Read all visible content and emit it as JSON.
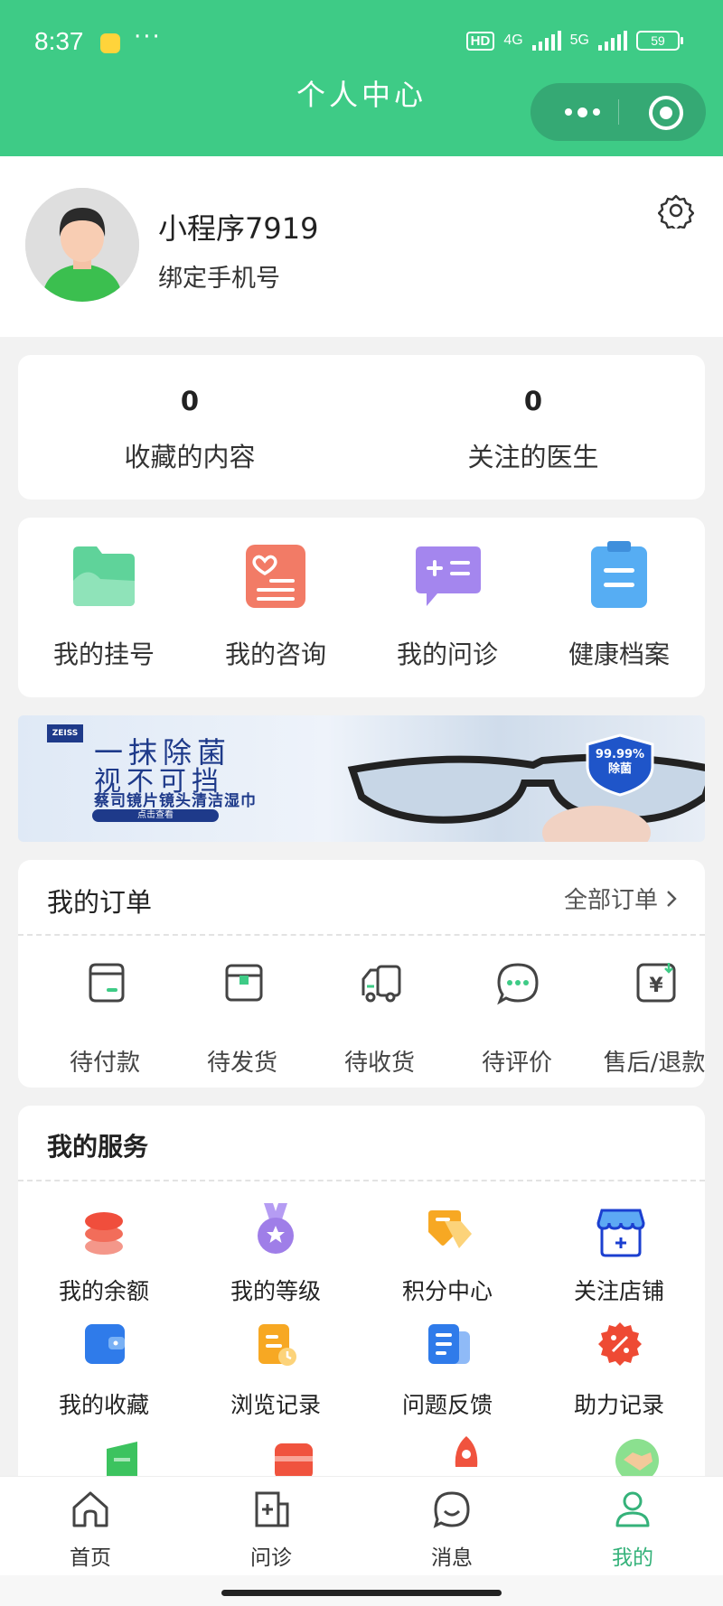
{
  "status_bar": {
    "time": "8:37",
    "more": "···",
    "hd": "HD",
    "net1": "4G",
    "net2": "5G",
    "battery": "59"
  },
  "header": {
    "title": "个人中心"
  },
  "profile": {
    "username": "小程序7919",
    "bind_phone": "绑定手机号"
  },
  "stats": [
    {
      "value": "0",
      "label": "收藏的内容"
    },
    {
      "value": "0",
      "label": "关注的医生"
    }
  ],
  "quick_actions": [
    {
      "label": "我的挂号",
      "icon": "folder-icon",
      "color": "#5fd39a"
    },
    {
      "label": "我的咨询",
      "icon": "heart-list-icon",
      "color": "#f27b66"
    },
    {
      "label": "我的问诊",
      "icon": "chat-plus-icon",
      "color": "#9f7ee8"
    },
    {
      "label": "健康档案",
      "icon": "clipboard-icon",
      "color": "#4ea3f1"
    }
  ],
  "banner": {
    "brand": "ZEISS",
    "line1": "一抹除菌",
    "line2": "视不可挡",
    "sub": "蔡司镜片镜头清洁湿巾",
    "cta": "点击查看",
    "badge_line1": "99.99%",
    "badge_line2": "除菌"
  },
  "orders": {
    "title": "我的订单",
    "all_label": "全部订单",
    "items": [
      {
        "label": "待付款",
        "icon": "wallet-icon"
      },
      {
        "label": "待发货",
        "icon": "box-icon"
      },
      {
        "label": "待收货",
        "icon": "truck-icon"
      },
      {
        "label": "待评价",
        "icon": "comment-icon"
      },
      {
        "label": "售后/退款",
        "icon": "refund-icon"
      }
    ]
  },
  "services": {
    "title": "我的服务",
    "items": [
      {
        "label": "我的余额",
        "icon": "coins-icon"
      },
      {
        "label": "我的等级",
        "icon": "medal-icon"
      },
      {
        "label": "积分中心",
        "icon": "tag-icon"
      },
      {
        "label": "关注店铺",
        "icon": "store-icon"
      },
      {
        "label": "我的收藏",
        "icon": "wallet-blue-icon"
      },
      {
        "label": "浏览记录",
        "icon": "history-icon"
      },
      {
        "label": "问题反馈",
        "icon": "feedback-icon"
      },
      {
        "label": "助力记录",
        "icon": "discount-icon"
      }
    ]
  },
  "tabbar": [
    {
      "label": "首页",
      "icon": "home-icon"
    },
    {
      "label": "问诊",
      "icon": "consult-icon"
    },
    {
      "label": "消息",
      "icon": "message-icon"
    },
    {
      "label": "我的",
      "icon": "user-icon",
      "active": true
    }
  ]
}
